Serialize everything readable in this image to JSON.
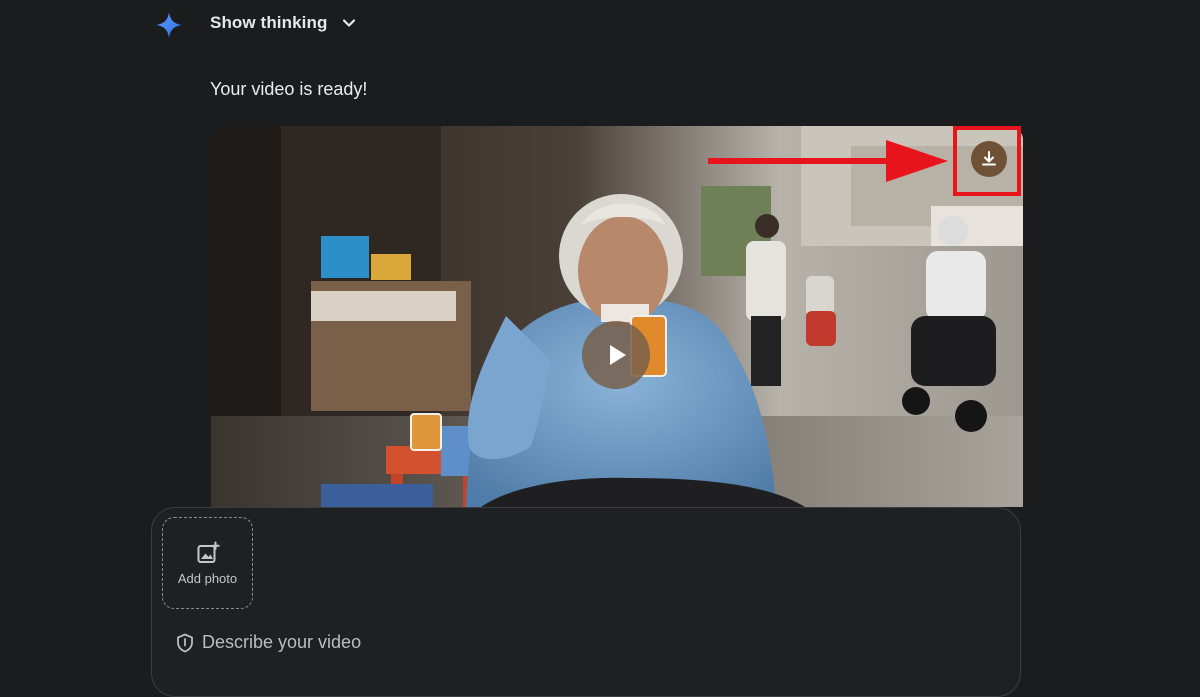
{
  "header": {
    "show_thinking_label": "Show thinking"
  },
  "message": {
    "text": "Your video is ready!"
  },
  "video": {
    "play_icon": "play-icon",
    "download_icon": "download-icon"
  },
  "composer": {
    "add_photo_label": "Add photo",
    "placeholder": "Describe your video"
  },
  "colors": {
    "background": "#1b1c1e",
    "accent_blue": "#4d8df7",
    "annotation_red": "#e8141b"
  }
}
